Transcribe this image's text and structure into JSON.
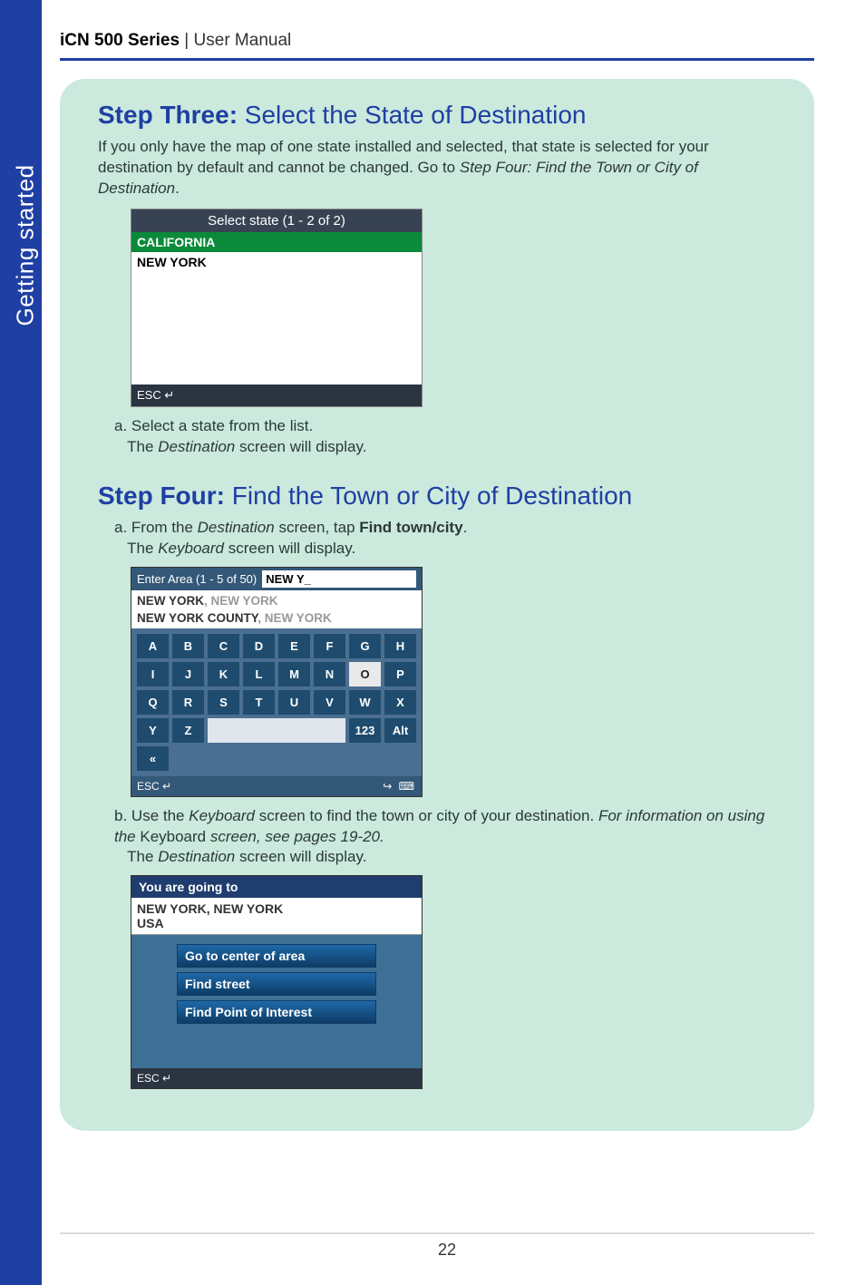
{
  "side_label": "Getting started",
  "header": {
    "product": "iCN 500 Series",
    "suffix": " | User Manual"
  },
  "page_number": "22",
  "step3": {
    "heading_bold": "Step Three:",
    "heading_rest": " Select the State of Destination",
    "intro_a": "If you only have the map of one state installed and selected, that state is selected for your destination by default and cannot be changed. Go to ",
    "intro_em": "Step Four: Find the Town or City of Destination",
    "intro_b": ".",
    "screen": {
      "title": "Select state (1 - 2 of 2)",
      "rows": [
        "CALIFORNIA",
        "NEW YORK"
      ],
      "esc": "ESC"
    },
    "sub_a_label": "a.",
    "sub_a_text": " Select a state from the list.",
    "sub_a_line2_a": "The ",
    "sub_a_line2_em": "Destination",
    "sub_a_line2_b": " screen will display."
  },
  "step4": {
    "heading_bold": "Step Four:",
    "heading_rest": " Find the Town or City of Destination",
    "sub_a_label": "a.",
    "sub_a_1a": " From the ",
    "sub_a_1em": "Destination",
    "sub_a_1b": " screen, tap ",
    "sub_a_1bold": "Find town/city",
    "sub_a_1c": ".",
    "sub_a_2a": "The ",
    "sub_a_2em": "Keyboard",
    "sub_a_2b": " screen will display.",
    "kb": {
      "title": "Enter Area (1 - 5 of 50)",
      "input": "NEW Y_",
      "results": [
        {
          "bold": "NEW YORK",
          "dim": ", NEW YORK"
        },
        {
          "bold": "NEW YORK COUNTY",
          "dim": ", NEW YORK"
        }
      ],
      "keys_row1": [
        "A",
        "B",
        "C",
        "D",
        "E",
        "F",
        "G",
        "H"
      ],
      "keys_row2": [
        "I",
        "J",
        "K",
        "L",
        "M",
        "N",
        "O",
        "P"
      ],
      "keys_row3": [
        "Q",
        "R",
        "S",
        "T",
        "U",
        "V",
        "W",
        "X"
      ],
      "keys_row4": [
        "Y",
        "Z",
        "",
        "",
        "",
        "123",
        "Alt",
        "«"
      ],
      "esc": "ESC",
      "icons_right": "↪ ⌨"
    },
    "sub_b_label": "b.",
    "sub_b_1a": " Use the ",
    "sub_b_1em": "Keyboard",
    "sub_b_1b": " screen to find the town or city of your destination. ",
    "sub_b_1em2": "For information on using the ",
    "sub_b_1plain": "Keyboard",
    "sub_b_1em3": " screen, see pages 19-20.",
    "sub_b_2a": "The ",
    "sub_b_2em": "Destination",
    "sub_b_2b": " screen will display.",
    "dest": {
      "title": "You are going to",
      "loc_line1": "NEW YORK, NEW YORK",
      "loc_line2": "USA",
      "buttons": [
        "Go to center of area",
        "Find street",
        "Find Point of Interest"
      ],
      "esc": "ESC"
    }
  }
}
